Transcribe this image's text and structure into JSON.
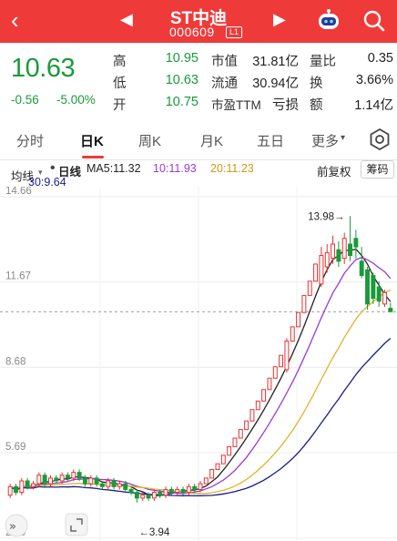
{
  "header": {
    "back_glyph": "‹",
    "prev_glyph": "◀",
    "next_glyph": "▶",
    "stock_name": "ST中迪",
    "stock_code": "000609",
    "level_badge": "L1",
    "icons": [
      "back-icon",
      "prev-stock-icon",
      "next-stock-icon",
      "robot-assistant-icon",
      "search-icon"
    ]
  },
  "quote": {
    "price": "10.63",
    "change": "-0.56",
    "change_pct": "-5.00%",
    "rows": [
      {
        "label": "高",
        "value": "10.95",
        "label2": "市值",
        "value2": "31.81亿",
        "label3": "量比",
        "value3": "0.35"
      },
      {
        "label": "低",
        "value": "10.63",
        "label2": "流通",
        "value2": "30.94亿",
        "label3": "换",
        "value3": "3.66%"
      },
      {
        "label": "开",
        "value": "10.75",
        "label2": "市盈TTM",
        "value2": "亏损",
        "label3": "额",
        "value3": "1.14亿"
      }
    ],
    "colors": {
      "down": "#1a9a3a",
      "up": "#e63232",
      "header": "#ef3a3a"
    }
  },
  "tabs": {
    "items": [
      "分时",
      "日K",
      "周K",
      "月K",
      "五日",
      "更多"
    ],
    "active": "日K",
    "more_caret": "▾"
  },
  "legend": {
    "ma_label": "均线",
    "ma_caret": "▾",
    "period": "日线",
    "ma5": "MA5:11.32",
    "ma10": "10:11.93",
    "ma20": "20:11.23",
    "ma30": "30:9.64",
    "adjust": "前复权",
    "chips": "筹码",
    "colors": {
      "ma5": "#222222",
      "ma10": "#9a3ad6",
      "ma20": "#e0b32a",
      "ma30": "#1c1c8a"
    }
  },
  "chart_data": {
    "type": "candlestick",
    "y_ticks": [
      "14.66",
      "11.67",
      "8.68",
      "5.69",
      "2.69"
    ],
    "ylim": [
      2.69,
      14.66
    ],
    "current_price": 10.63,
    "annotations": {
      "high": "13.98→",
      "low": "←3.94"
    },
    "candles": [
      {
        "o": 4.2,
        "c": 4.5,
        "h": 4.6,
        "l": 4.1
      },
      {
        "o": 4.5,
        "c": 4.3,
        "h": 4.6,
        "l": 4.2
      },
      {
        "o": 4.3,
        "c": 4.7,
        "h": 4.8,
        "l": 4.2
      },
      {
        "o": 4.7,
        "c": 4.5,
        "h": 4.8,
        "l": 4.4
      },
      {
        "o": 4.5,
        "c": 4.6,
        "h": 4.7,
        "l": 4.4
      },
      {
        "o": 4.6,
        "c": 4.9,
        "h": 5.0,
        "l": 4.5
      },
      {
        "o": 4.9,
        "c": 4.6,
        "h": 5.0,
        "l": 4.5
      },
      {
        "o": 4.6,
        "c": 4.8,
        "h": 4.9,
        "l": 4.5
      },
      {
        "o": 4.8,
        "c": 4.7,
        "h": 4.9,
        "l": 4.6
      },
      {
        "o": 4.7,
        "c": 4.9,
        "h": 5.0,
        "l": 4.6
      },
      {
        "o": 4.9,
        "c": 4.8,
        "h": 5.0,
        "l": 4.7
      },
      {
        "o": 4.8,
        "c": 5.0,
        "h": 5.1,
        "l": 4.7
      },
      {
        "o": 5.0,
        "c": 4.8,
        "h": 5.1,
        "l": 4.7
      },
      {
        "o": 4.8,
        "c": 4.6,
        "h": 4.9,
        "l": 4.5
      },
      {
        "o": 4.6,
        "c": 4.8,
        "h": 4.9,
        "l": 4.5
      },
      {
        "o": 4.8,
        "c": 4.6,
        "h": 4.9,
        "l": 4.5
      },
      {
        "o": 4.6,
        "c": 4.5,
        "h": 4.7,
        "l": 4.4
      },
      {
        "o": 4.5,
        "c": 4.7,
        "h": 4.8,
        "l": 4.4
      },
      {
        "o": 4.7,
        "c": 4.5,
        "h": 4.8,
        "l": 4.4
      },
      {
        "o": 4.5,
        "c": 4.6,
        "h": 4.7,
        "l": 4.4
      },
      {
        "o": 4.6,
        "c": 4.4,
        "h": 4.7,
        "l": 4.3
      },
      {
        "o": 4.4,
        "c": 4.3,
        "h": 4.5,
        "l": 4.2
      },
      {
        "o": 4.3,
        "c": 4.1,
        "h": 4.4,
        "l": 3.94
      },
      {
        "o": 4.1,
        "c": 4.2,
        "h": 4.3,
        "l": 4.0
      },
      {
        "o": 4.2,
        "c": 4.1,
        "h": 4.3,
        "l": 4.0
      },
      {
        "o": 4.1,
        "c": 4.3,
        "h": 4.4,
        "l": 4.0
      },
      {
        "o": 4.3,
        "c": 4.2,
        "h": 4.4,
        "l": 4.1
      },
      {
        "o": 4.2,
        "c": 4.4,
        "h": 4.5,
        "l": 4.1
      },
      {
        "o": 4.4,
        "c": 4.3,
        "h": 4.5,
        "l": 4.2
      },
      {
        "o": 4.3,
        "c": 4.4,
        "h": 4.5,
        "l": 4.2
      },
      {
        "o": 4.4,
        "c": 4.3,
        "h": 4.5,
        "l": 4.2
      },
      {
        "o": 4.3,
        "c": 4.5,
        "h": 4.6,
        "l": 4.2
      },
      {
        "o": 4.5,
        "c": 4.4,
        "h": 4.6,
        "l": 4.3
      },
      {
        "o": 4.4,
        "c": 4.6,
        "h": 4.7,
        "l": 4.3
      },
      {
        "o": 4.6,
        "c": 4.8,
        "h": 4.8,
        "l": 4.6
      },
      {
        "o": 4.8,
        "c": 5.1,
        "h": 5.1,
        "l": 4.8
      },
      {
        "o": 5.1,
        "c": 5.3,
        "h": 5.3,
        "l": 5.1
      },
      {
        "o": 5.3,
        "c": 5.6,
        "h": 5.6,
        "l": 5.3
      },
      {
        "o": 5.6,
        "c": 5.9,
        "h": 5.9,
        "l": 5.6
      },
      {
        "o": 5.9,
        "c": 6.2,
        "h": 6.2,
        "l": 5.9
      },
      {
        "o": 6.2,
        "c": 6.5,
        "h": 6.5,
        "l": 6.2
      },
      {
        "o": 6.5,
        "c": 6.8,
        "h": 6.8,
        "l": 6.5
      },
      {
        "o": 6.8,
        "c": 7.2,
        "h": 7.2,
        "l": 6.8
      },
      {
        "o": 7.2,
        "c": 7.5,
        "h": 7.5,
        "l": 7.2
      },
      {
        "o": 7.5,
        "c": 7.9,
        "h": 7.9,
        "l": 7.5
      },
      {
        "o": 7.9,
        "c": 8.3,
        "h": 8.3,
        "l": 7.9
      },
      {
        "o": 8.3,
        "c": 8.7,
        "h": 8.7,
        "l": 8.3
      },
      {
        "o": 8.7,
        "c": 9.1,
        "h": 9.1,
        "l": 8.7
      },
      {
        "o": 8.6,
        "c": 9.6,
        "h": 9.7,
        "l": 8.5
      },
      {
        "o": 9.6,
        "c": 10.1,
        "h": 10.1,
        "l": 9.6
      },
      {
        "o": 10.1,
        "c": 10.6,
        "h": 10.6,
        "l": 10.1
      },
      {
        "o": 10.6,
        "c": 11.2,
        "h": 11.2,
        "l": 10.6
      },
      {
        "o": 11.2,
        "c": 11.7,
        "h": 11.7,
        "l": 11.2
      },
      {
        "o": 11.7,
        "c": 12.3,
        "h": 12.3,
        "l": 11.7
      },
      {
        "o": 11.6,
        "c": 12.6,
        "h": 12.9,
        "l": 11.5
      },
      {
        "o": 12.2,
        "c": 12.7,
        "h": 13.0,
        "l": 12.0
      },
      {
        "o": 12.5,
        "c": 13.0,
        "h": 13.3,
        "l": 12.3
      },
      {
        "o": 12.8,
        "c": 12.4,
        "h": 13.1,
        "l": 12.2
      },
      {
        "o": 12.5,
        "c": 13.2,
        "h": 13.4,
        "l": 12.3
      },
      {
        "o": 13.0,
        "c": 12.6,
        "h": 13.98,
        "l": 12.4
      },
      {
        "o": 13.2,
        "c": 12.9,
        "h": 13.5,
        "l": 12.5
      },
      {
        "o": 12.4,
        "c": 11.9,
        "h": 12.9,
        "l": 11.8
      },
      {
        "o": 12.1,
        "c": 10.9,
        "h": 12.2,
        "l": 10.7
      },
      {
        "o": 11.9,
        "c": 11.1,
        "h": 12.0,
        "l": 10.9
      },
      {
        "o": 11.5,
        "c": 11.0,
        "h": 11.7,
        "l": 10.8
      },
      {
        "o": 10.9,
        "c": 11.3,
        "h": 11.4,
        "l": 10.8
      },
      {
        "o": 10.75,
        "c": 10.63,
        "h": 10.95,
        "l": 10.63
      }
    ]
  }
}
